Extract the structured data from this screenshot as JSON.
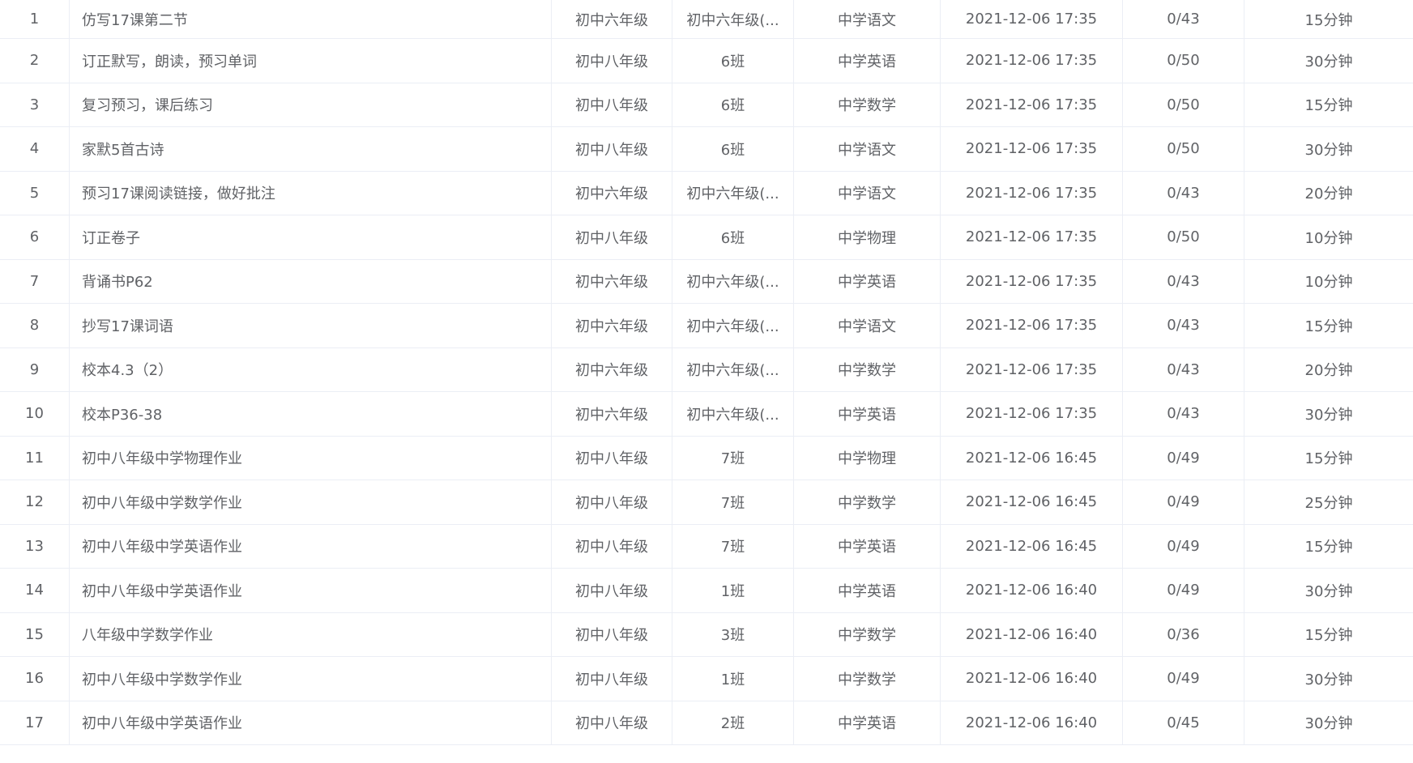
{
  "table": {
    "rows": [
      {
        "index": "1",
        "name": "仿写17课第二节",
        "grade": "初中六年级",
        "class": "初中六年级(...",
        "subject": "中学语文",
        "time": "2021-12-06 17:35",
        "completion": "0/43",
        "duration": "15分钟"
      },
      {
        "index": "2",
        "name": "订正默写，朗读，预习单词",
        "grade": "初中八年级",
        "class": "6班",
        "subject": "中学英语",
        "time": "2021-12-06 17:35",
        "completion": "0/50",
        "duration": "30分钟"
      },
      {
        "index": "3",
        "name": "复习预习，课后练习",
        "grade": "初中八年级",
        "class": "6班",
        "subject": "中学数学",
        "time": "2021-12-06 17:35",
        "completion": "0/50",
        "duration": "15分钟"
      },
      {
        "index": "4",
        "name": "家默5首古诗",
        "grade": "初中八年级",
        "class": "6班",
        "subject": "中学语文",
        "time": "2021-12-06 17:35",
        "completion": "0/50",
        "duration": "30分钟"
      },
      {
        "index": "5",
        "name": "预习17课阅读链接，做好批注",
        "grade": "初中六年级",
        "class": "初中六年级(...",
        "subject": "中学语文",
        "time": "2021-12-06 17:35",
        "completion": "0/43",
        "duration": "20分钟"
      },
      {
        "index": "6",
        "name": "订正卷子",
        "grade": "初中八年级",
        "class": "6班",
        "subject": "中学物理",
        "time": "2021-12-06 17:35",
        "completion": "0/50",
        "duration": "10分钟"
      },
      {
        "index": "7",
        "name": "背诵书P62",
        "grade": "初中六年级",
        "class": "初中六年级(...",
        "subject": "中学英语",
        "time": "2021-12-06 17:35",
        "completion": "0/43",
        "duration": "10分钟"
      },
      {
        "index": "8",
        "name": "抄写17课词语",
        "grade": "初中六年级",
        "class": "初中六年级(...",
        "subject": "中学语文",
        "time": "2021-12-06 17:35",
        "completion": "0/43",
        "duration": "15分钟"
      },
      {
        "index": "9",
        "name": "校本4.3（2）",
        "grade": "初中六年级",
        "class": "初中六年级(...",
        "subject": "中学数学",
        "time": "2021-12-06 17:35",
        "completion": "0/43",
        "duration": "20分钟"
      },
      {
        "index": "10",
        "name": "校本P36-38",
        "grade": "初中六年级",
        "class": "初中六年级(...",
        "subject": "中学英语",
        "time": "2021-12-06 17:35",
        "completion": "0/43",
        "duration": "30分钟"
      },
      {
        "index": "11",
        "name": "初中八年级中学物理作业",
        "grade": "初中八年级",
        "class": "7班",
        "subject": "中学物理",
        "time": "2021-12-06 16:45",
        "completion": "0/49",
        "duration": "15分钟"
      },
      {
        "index": "12",
        "name": "初中八年级中学数学作业",
        "grade": "初中八年级",
        "class": "7班",
        "subject": "中学数学",
        "time": "2021-12-06 16:45",
        "completion": "0/49",
        "duration": "25分钟"
      },
      {
        "index": "13",
        "name": "初中八年级中学英语作业",
        "grade": "初中八年级",
        "class": "7班",
        "subject": "中学英语",
        "time": "2021-12-06 16:45",
        "completion": "0/49",
        "duration": "15分钟"
      },
      {
        "index": "14",
        "name": "初中八年级中学英语作业",
        "grade": "初中八年级",
        "class": "1班",
        "subject": "中学英语",
        "time": "2021-12-06 16:40",
        "completion": "0/49",
        "duration": "30分钟"
      },
      {
        "index": "15",
        "name": "八年级中学数学作业",
        "grade": "初中八年级",
        "class": "3班",
        "subject": "中学数学",
        "time": "2021-12-06 16:40",
        "completion": "0/36",
        "duration": "15分钟"
      },
      {
        "index": "16",
        "name": "初中八年级中学数学作业",
        "grade": "初中八年级",
        "class": "1班",
        "subject": "中学数学",
        "time": "2021-12-06 16:40",
        "completion": "0/49",
        "duration": "30分钟"
      },
      {
        "index": "17",
        "name": "初中八年级中学英语作业",
        "grade": "初中八年级",
        "class": "2班",
        "subject": "中学英语",
        "time": "2021-12-06 16:40",
        "completion": "0/45",
        "duration": "30分钟"
      }
    ]
  }
}
